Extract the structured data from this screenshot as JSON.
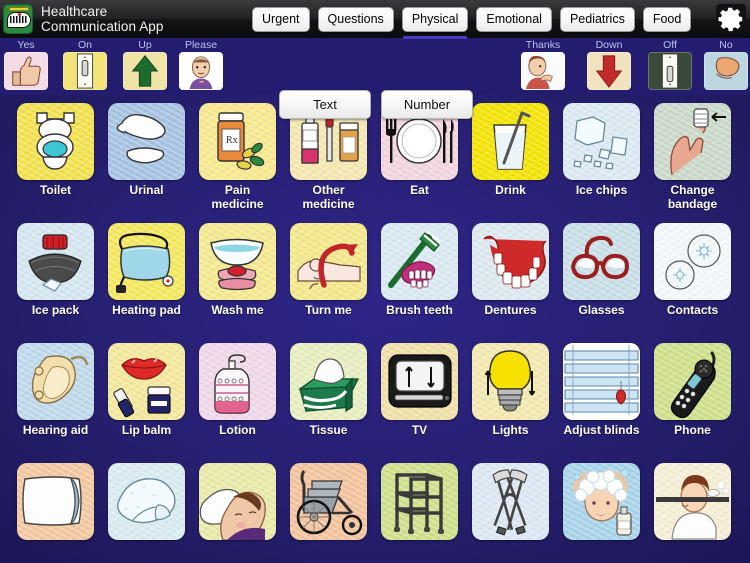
{
  "app": {
    "logo_icon": "speech-bubble-logo-icon",
    "title_line1": "Healthcare",
    "title_line2": "Communication App"
  },
  "tabs": [
    {
      "label": "Urgent",
      "active": false
    },
    {
      "label": "Questions",
      "active": false
    },
    {
      "label": "Physical",
      "active": true
    },
    {
      "label": "Emotional",
      "active": false
    },
    {
      "label": "Pediatrics",
      "active": false
    },
    {
      "label": "Food",
      "active": false
    }
  ],
  "settings": {
    "icon": "gear-icon",
    "label": "Settings"
  },
  "quickbar": {
    "left_items": [
      {
        "label": "Yes",
        "icon": "thumbs-up-icon"
      },
      {
        "label": "On",
        "icon": "light-switch-on-icon"
      },
      {
        "label": "Up",
        "icon": "up-arrow-icon"
      },
      {
        "label": "Please",
        "icon": "please-sign-icon"
      }
    ],
    "right_items": [
      {
        "label": "Thanks",
        "icon": "thank-you-sign-icon"
      },
      {
        "label": "Down",
        "icon": "down-arrow-icon"
      },
      {
        "label": "Off",
        "icon": "light-switch-off-icon"
      },
      {
        "label": "No",
        "icon": "thumbs-down-icon"
      }
    ],
    "buttons": [
      {
        "label": "Text"
      },
      {
        "label": "Number"
      }
    ]
  },
  "grid": {
    "rows": [
      [
        {
          "label": "Toilet",
          "icon": "toilet-icon"
        },
        {
          "label": "Urinal",
          "icon": "urinal-icon"
        },
        {
          "label": "Pain\nmedicine",
          "icon": "pill-bottle-icon"
        },
        {
          "label": "Other\nmedicine",
          "icon": "medicine-bottles-icon"
        },
        {
          "label": "Eat",
          "icon": "plate-utensils-icon"
        },
        {
          "label": "Drink",
          "icon": "glass-straw-icon"
        },
        {
          "label": "Ice chips",
          "icon": "ice-cubes-icon"
        },
        {
          "label": "Change\nbandage",
          "icon": "bandaged-finger-icon"
        }
      ],
      [
        {
          "label": "Ice pack",
          "icon": "ice-pack-icon"
        },
        {
          "label": "Heating pad",
          "icon": "heating-pad-icon"
        },
        {
          "label": "Wash me",
          "icon": "wash-basin-icon"
        },
        {
          "label": "Turn me",
          "icon": "turn-patient-icon"
        },
        {
          "label": "Brush teeth",
          "icon": "toothbrush-icon"
        },
        {
          "label": "Dentures",
          "icon": "dentures-icon"
        },
        {
          "label": "Glasses",
          "icon": "eyeglasses-icon"
        },
        {
          "label": "Contacts",
          "icon": "contact-lenses-icon"
        }
      ],
      [
        {
          "label": "Hearing aid",
          "icon": "hearing-aid-icon"
        },
        {
          "label": "Lip balm",
          "icon": "lip-balm-icon"
        },
        {
          "label": "Lotion",
          "icon": "lotion-bottle-icon"
        },
        {
          "label": "Tissue",
          "icon": "tissue-box-icon"
        },
        {
          "label": "TV",
          "icon": "television-icon"
        },
        {
          "label": "Lights",
          "icon": "lightbulb-icon"
        },
        {
          "label": "Adjust blinds",
          "icon": "window-blinds-icon"
        },
        {
          "label": "Phone",
          "icon": "cordless-phone-icon"
        }
      ],
      [
        {
          "label": "",
          "icon": "pillow-icon"
        },
        {
          "label": "",
          "icon": "blanket-icon"
        },
        {
          "label": "",
          "icon": "sleeping-patient-icon"
        },
        {
          "label": "",
          "icon": "wheelchair-icon"
        },
        {
          "label": "",
          "icon": "walker-icon"
        },
        {
          "label": "",
          "icon": "crutches-icon"
        },
        {
          "label": "",
          "icon": "shampoo-hair-wash-icon"
        },
        {
          "label": "",
          "icon": "shave-mirror-icon"
        }
      ]
    ]
  },
  "colors": {
    "background": "#241c6e",
    "tab_accent": "#4a3ec0",
    "label_text": "#ffffff",
    "quick_label_text": "#b9c3ef",
    "topbar": "#1a1a1c"
  }
}
